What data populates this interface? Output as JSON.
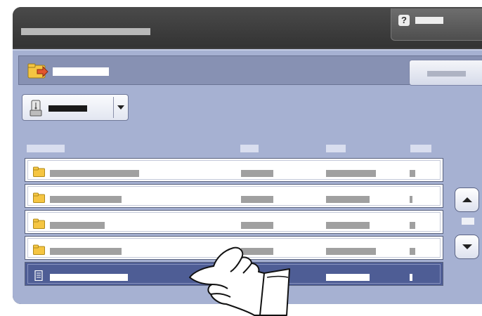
{
  "header": {
    "title": "",
    "help_label": "",
    "help_icon_glyph": "?"
  },
  "pathbar": {
    "icon": "folder-up-icon",
    "path": "",
    "action_label": ""
  },
  "source_selector": {
    "icon": "usb-drive-icon",
    "selected_value": ""
  },
  "list": {
    "columns": [
      "",
      "",
      "",
      ""
    ],
    "rows": [
      {
        "type": "folder",
        "icon": "folder-icon",
        "name": "",
        "col2": "",
        "col3": "",
        "col4": "",
        "selected": false
      },
      {
        "type": "folder",
        "icon": "folder-icon",
        "name": "",
        "col2": "",
        "col3": "",
        "col4": "",
        "selected": false
      },
      {
        "type": "folder",
        "icon": "folder-icon",
        "name": "",
        "col2": "",
        "col3": "",
        "col4": "",
        "selected": false
      },
      {
        "type": "folder",
        "icon": "folder-icon",
        "name": "",
        "col2": "",
        "col3": "",
        "col4": "",
        "selected": false
      },
      {
        "type": "file",
        "icon": "document-icon",
        "name": "",
        "col2": "",
        "col3": "",
        "col4": "",
        "selected": true
      }
    ]
  },
  "scroll": {
    "up_icon": "arrow-up-icon",
    "down_icon": "arrow-down-icon",
    "page_indicator": ""
  },
  "overlay": {
    "icon": "pointing-hand-icon"
  },
  "colors": {
    "panel": "#a6b1d2",
    "pathbar": "#8791b3",
    "selected_row": "#4e5d95",
    "titlebar": "#3f3f3f",
    "folder": "#f5c542"
  }
}
